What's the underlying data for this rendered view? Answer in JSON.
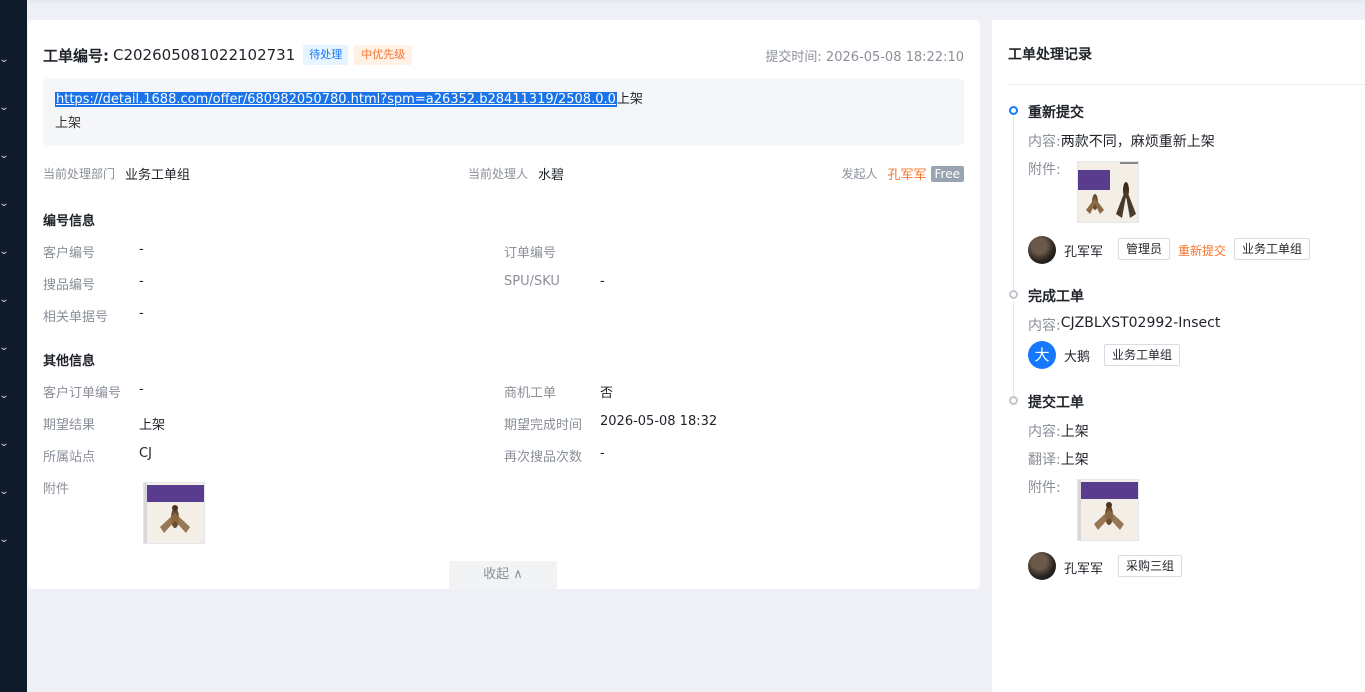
{
  "ticket": {
    "title": "工单编号:",
    "number": "C202605081022102731",
    "status_tag": "待处理",
    "priority_tag": "中优先级",
    "submit_time": "提交时间: 2026-05-08 18:22:10",
    "description_link": "https://detail.1688.com/offer/680982050780.html?spm=a26352.b28411319/2508.0.0",
    "description_suffix": "上架",
    "description_line2": "上架"
  },
  "handling": {
    "dept_label": "当前处理部门",
    "dept_value": "业务工单组",
    "handler_label": "当前处理人",
    "handler_value": "水碧",
    "initiator_label": "发起人",
    "initiator_value": "孔军军",
    "initiator_badge": "Free"
  },
  "number_info": {
    "title": "编号信息",
    "fields": [
      {
        "label": "客户编号",
        "value": "-"
      },
      {
        "label": "订单编号",
        "value": ""
      },
      {
        "label": "搜品编号",
        "value": "-"
      },
      {
        "label": "SPU/SKU",
        "value": "-"
      },
      {
        "label": "相关单据号",
        "value": "-"
      }
    ]
  },
  "other_info": {
    "title": "其他信息",
    "fields": [
      {
        "label": "客户订单编号",
        "value": "-"
      },
      {
        "label": "商机工单",
        "value": "否"
      },
      {
        "label": "期望结果",
        "value": "上架"
      },
      {
        "label": "期望完成时间",
        "value": "2026-05-08 18:32"
      },
      {
        "label": "所属站点",
        "value": "CJ"
      },
      {
        "label": "再次搜品次数",
        "value": "-"
      },
      {
        "label": "附件",
        "value": ""
      }
    ]
  },
  "collapse_label": "收起 ∧",
  "records": {
    "title": "工单处理记录",
    "items": [
      {
        "title": "重新提交",
        "content_label": "内容:",
        "content": "两款不同，麻烦重新上架",
        "attach_label": "附件:",
        "user": "孔军军",
        "chips": [
          "管理员"
        ],
        "action": "重新提交",
        "group": "业务工单组"
      },
      {
        "title": "完成工单",
        "content_label": "内容:",
        "content": "CJZBLXST02992-Insect",
        "avatar_letter": "大",
        "user": "大鹅",
        "group": "业务工单组"
      },
      {
        "title": "提交工单",
        "content_label": "内容:",
        "content": "上架",
        "translate_label": "翻译:",
        "translate": "上架",
        "attach_label": "附件:",
        "user": "孔军军",
        "group": "采购三组"
      }
    ]
  },
  "colors": {
    "accent": "#1677ff",
    "orange": "#f5742a",
    "nav": "#0f1a2a"
  }
}
